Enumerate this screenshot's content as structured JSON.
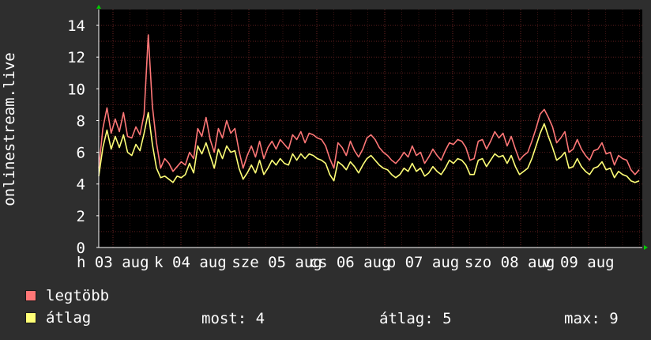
{
  "chart_data": {
    "type": "line",
    "ylabel": "onlinestream.live",
    "ylim": [
      0,
      15
    ],
    "y_ticks": [
      "0",
      "2",
      "4",
      "6",
      "8",
      "10",
      "12",
      "14"
    ],
    "x_tick_labels": [
      "h 03 aug",
      "k 04 aug",
      "sze 05 aug",
      "cs 06 aug",
      "p 07 aug",
      "szo 08 aug",
      "v 09 aug"
    ],
    "grid": true,
    "legend_position": "bottom",
    "colors": {
      "background": "#000000",
      "grid": "#5a1e1e",
      "axis": "#ffffff",
      "page": "#2e2e2e"
    },
    "series": [
      {
        "name": "legtöbb",
        "color": "#ff7777",
        "values": [
          5.0,
          7.5,
          8.8,
          7.2,
          8.1,
          7.3,
          8.5,
          7.0,
          6.9,
          7.6,
          7.1,
          8.4,
          13.4,
          8.9,
          6.6,
          5.0,
          5.6,
          5.3,
          4.8,
          5.1,
          5.4,
          5.2,
          6.0,
          5.6,
          7.5,
          7.0,
          8.2,
          6.8,
          6.0,
          7.5,
          6.9,
          8.0,
          7.2,
          7.5,
          6.1,
          5.0,
          5.8,
          6.4,
          5.7,
          6.7,
          5.6,
          6.3,
          6.7,
          6.2,
          6.8,
          6.5,
          6.2,
          7.1,
          6.8,
          7.3,
          6.6,
          7.2,
          7.1,
          6.9,
          6.8,
          6.4,
          5.6,
          5.0,
          6.6,
          6.3,
          5.8,
          6.7,
          6.1,
          5.7,
          6.2,
          6.9,
          7.1,
          6.8,
          6.3,
          6.0,
          5.8,
          5.5,
          5.3,
          5.6,
          6.0,
          5.7,
          6.4,
          5.8,
          6.0,
          5.3,
          5.7,
          6.2,
          5.8,
          5.5,
          6.1,
          6.6,
          6.5,
          6.8,
          6.7,
          6.3,
          5.5,
          5.6,
          6.7,
          6.8,
          6.2,
          6.7,
          7.3,
          6.9,
          7.2,
          6.4,
          7.0,
          6.2,
          5.5,
          5.8,
          6.0,
          6.7,
          7.5,
          8.4,
          8.7,
          8.2,
          7.6,
          6.6,
          6.9,
          7.3,
          6.0,
          6.2,
          6.8,
          6.2,
          5.8,
          5.5,
          6.1,
          6.2,
          6.6,
          5.9,
          6.0,
          5.2,
          5.8,
          5.6,
          5.5,
          4.9,
          4.6,
          4.9
        ]
      },
      {
        "name": "átlag",
        "color": "#ffff77",
        "values": [
          4.5,
          6.3,
          7.4,
          6.2,
          7.0,
          6.3,
          7.1,
          6.0,
          5.8,
          6.5,
          6.1,
          7.2,
          8.5,
          6.5,
          5.0,
          4.4,
          4.5,
          4.3,
          4.1,
          4.5,
          4.4,
          4.6,
          5.3,
          4.7,
          6.4,
          5.9,
          6.6,
          5.8,
          5.0,
          6.2,
          5.6,
          6.4,
          6.0,
          6.1,
          5.0,
          4.3,
          4.7,
          5.2,
          4.7,
          5.5,
          4.6,
          5.0,
          5.5,
          5.2,
          5.6,
          5.3,
          5.2,
          5.9,
          5.5,
          5.9,
          5.6,
          5.9,
          5.8,
          5.6,
          5.5,
          5.3,
          4.6,
          4.2,
          5.4,
          5.2,
          4.9,
          5.4,
          5.1,
          4.7,
          5.2,
          5.6,
          5.8,
          5.5,
          5.2,
          5.0,
          4.9,
          4.6,
          4.4,
          4.6,
          5.0,
          4.8,
          5.3,
          4.8,
          5.0,
          4.5,
          4.7,
          5.1,
          4.8,
          4.6,
          5.0,
          5.5,
          5.3,
          5.6,
          5.5,
          5.2,
          4.6,
          4.6,
          5.5,
          5.6,
          5.1,
          5.5,
          5.9,
          5.7,
          5.8,
          5.3,
          5.8,
          5.1,
          4.6,
          4.8,
          5.0,
          5.6,
          6.4,
          7.2,
          7.8,
          7.0,
          6.3,
          5.5,
          5.7,
          6.0,
          5.0,
          5.1,
          5.6,
          5.1,
          4.8,
          4.6,
          5.0,
          5.1,
          5.4,
          4.9,
          5.0,
          4.4,
          4.8,
          4.6,
          4.5,
          4.2,
          4.1,
          4.2
        ]
      }
    ]
  },
  "legend": {
    "items": [
      {
        "label": "legtöbb",
        "color": "#ff7777"
      },
      {
        "label": "átlag",
        "color": "#ffff77"
      }
    ],
    "stats": {
      "current": "most: 4",
      "average": "átlag: 5",
      "max": "max: 9"
    }
  }
}
